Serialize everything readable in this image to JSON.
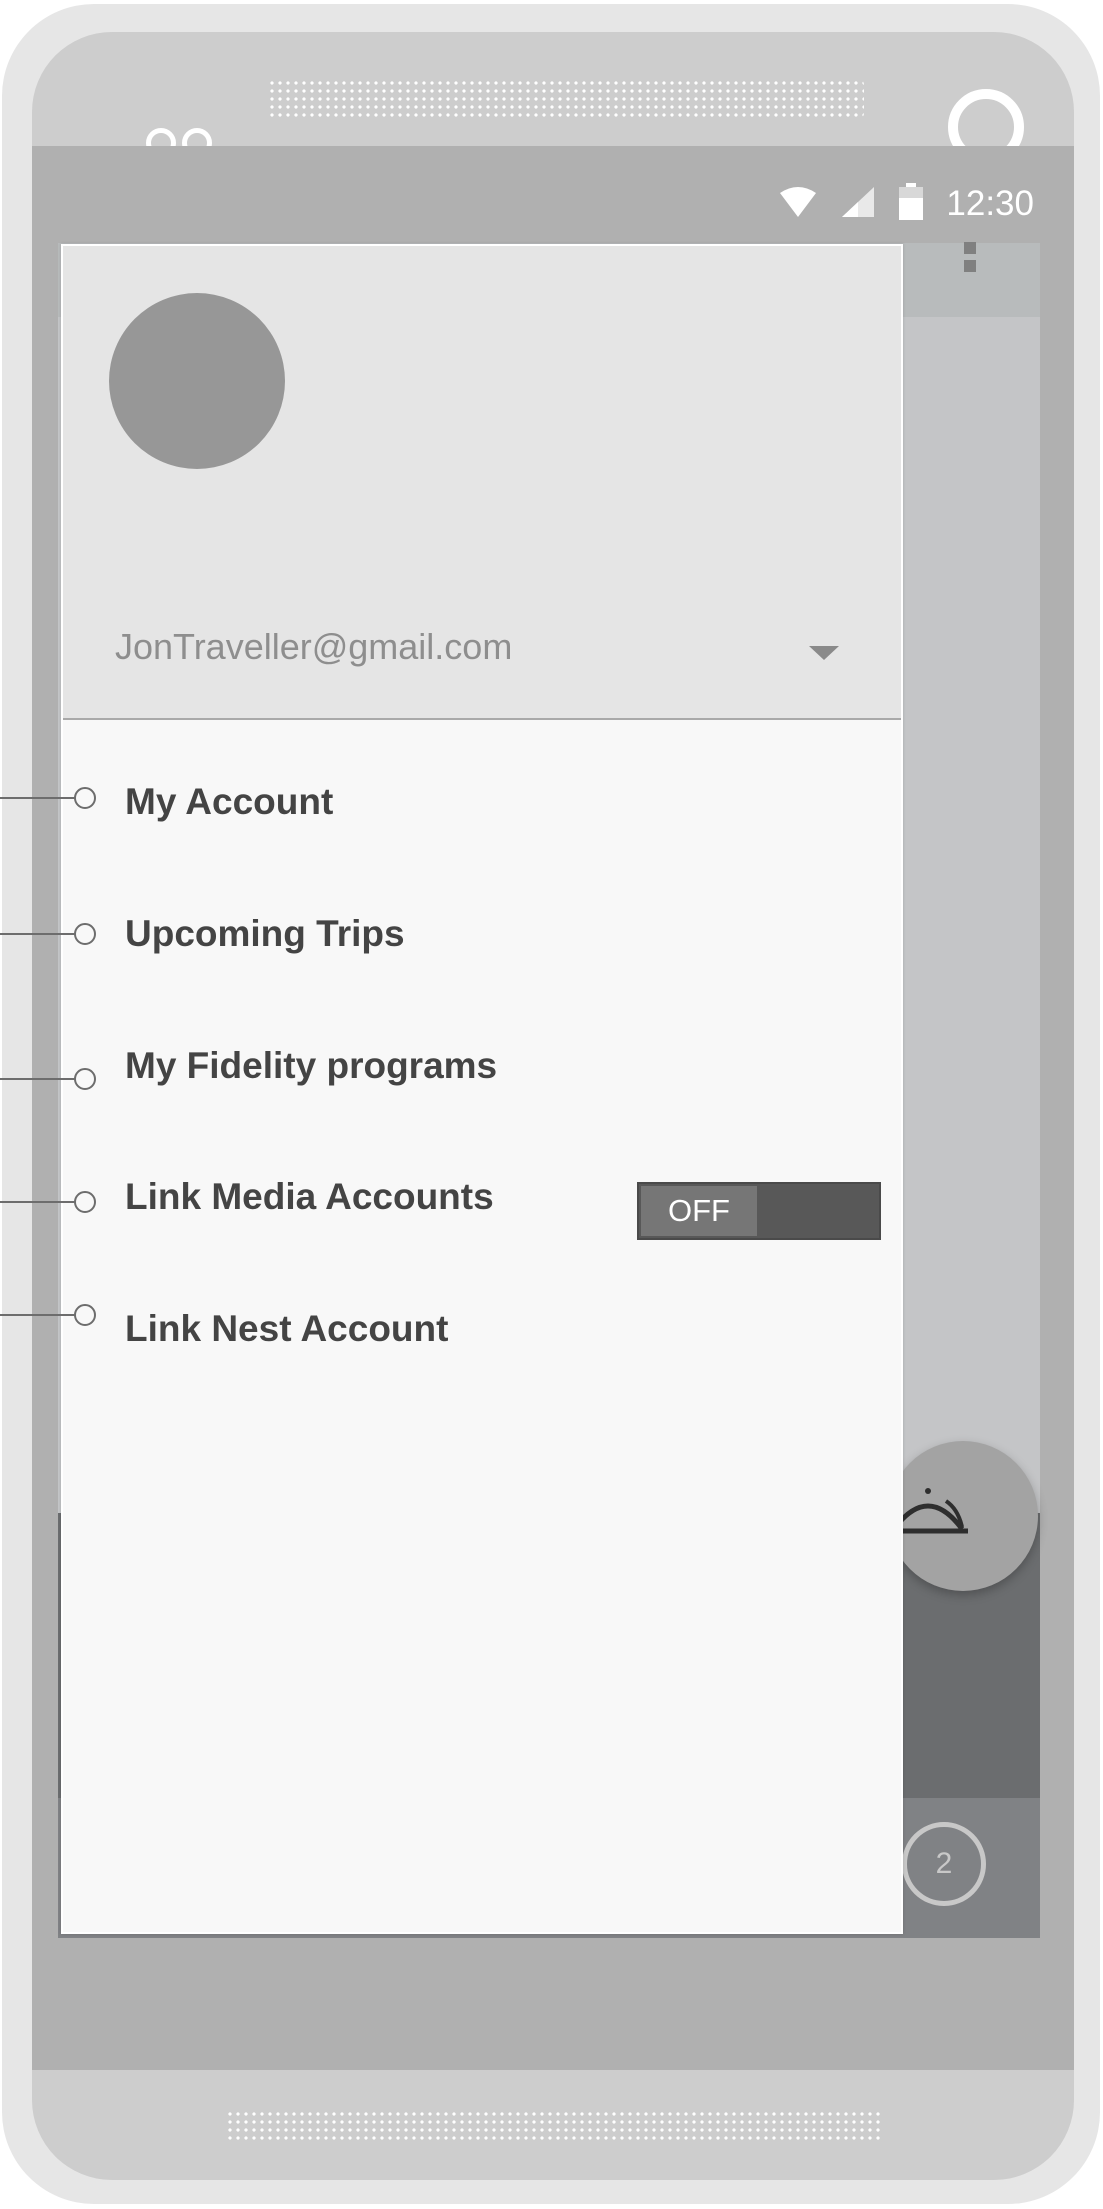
{
  "status_bar": {
    "time": "12:30",
    "icons": [
      "wifi-icon",
      "cellular-signal-icon",
      "battery-icon"
    ]
  },
  "drawer": {
    "account_email": "JonTraveller@gmail.com",
    "menu_items": [
      {
        "label": "My Account"
      },
      {
        "label": "Upcoming Trips"
      },
      {
        "label": "My Fidelity programs"
      },
      {
        "label": "Link Media Accounts"
      },
      {
        "label": "Link Nest Account"
      }
    ],
    "media_toggle": {
      "label": "OFF"
    }
  },
  "background_app": {
    "fab_icon": "room-service-bell-icon",
    "badge_text": "2"
  },
  "colors": {
    "phone_body": "#e6e6e6",
    "screen_bg": "#b0b0b0",
    "drawer_bg": "#f8f8f8",
    "drawer_header_bg": "#e5e5e5",
    "toggle_bg": "#585858"
  }
}
